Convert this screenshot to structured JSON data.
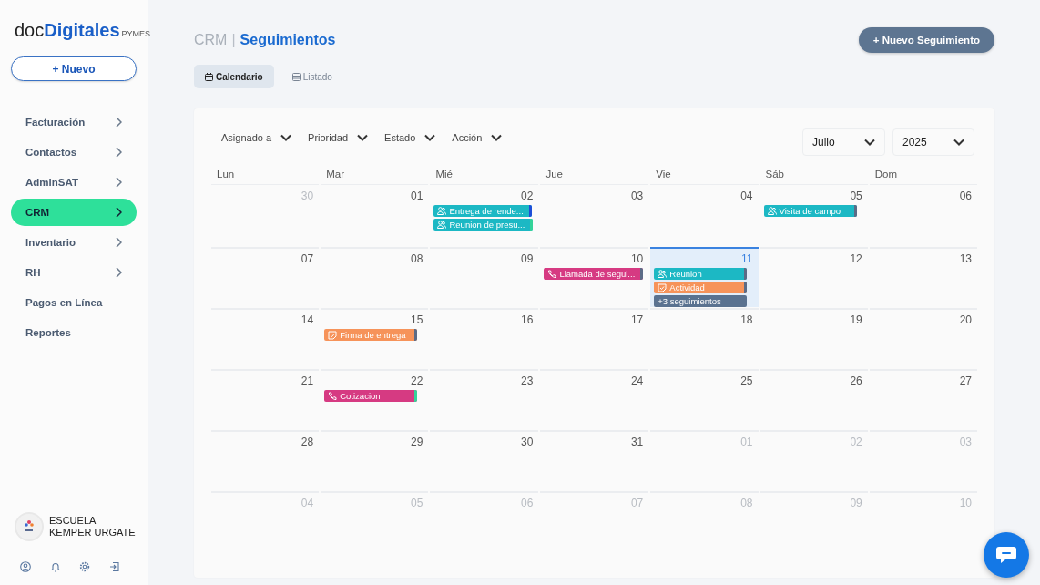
{
  "sidebar": {
    "logo": {
      "prefix": "doc",
      "brand": "Digitales",
      "suffix": "PYMES"
    },
    "new_button": {
      "icon": "+",
      "label": "Nuevo"
    },
    "items": [
      {
        "label": "Facturación",
        "has_submenu": true,
        "selected": false
      },
      {
        "label": "Contactos",
        "has_submenu": true,
        "selected": false
      },
      {
        "label": "AdminSAT",
        "has_submenu": true,
        "selected": false
      },
      {
        "label": "CRM",
        "has_submenu": true,
        "selected": true
      },
      {
        "label": "Inventario",
        "has_submenu": true,
        "selected": false
      },
      {
        "label": "RH",
        "has_submenu": true,
        "selected": false
      },
      {
        "label": "Pagos en Línea",
        "has_submenu": false,
        "selected": false
      },
      {
        "label": "Reportes",
        "has_submenu": false,
        "selected": false
      }
    ],
    "account": {
      "name": "ESCUELA KEMPER URGATE"
    }
  },
  "header": {
    "section": "CRM",
    "separator": "|",
    "title": "Seguimientos",
    "new_button": {
      "icon": "+",
      "label": "Nuevo Seguimiento"
    }
  },
  "tabs": [
    {
      "label": "Calendario",
      "kind": "calendar",
      "selected": true
    },
    {
      "label": "Listado",
      "kind": "list",
      "selected": false
    }
  ],
  "filters": [
    "Asignado a",
    "Prioridad",
    "Estado",
    "Acción"
  ],
  "month_select": {
    "value": "Julio"
  },
  "year_select": {
    "value": "2025"
  },
  "weekdays": [
    "Lun",
    "Mar",
    "Mié",
    "Jue",
    "Vie",
    "Sáb",
    "Dom"
  ],
  "weeks": [
    [
      {
        "day": "30",
        "outside": true,
        "today": false
      },
      {
        "day": "01",
        "outside": false,
        "today": false
      },
      {
        "day": "02",
        "outside": false,
        "today": false,
        "events": [
          {
            "kind": "meeting",
            "label": "Entrega de rende...",
            "color": "#1cb8c4",
            "stripe": {
              "color": "#1d4ed8"
            }
          },
          {
            "kind": "meeting",
            "label": "Reunion de presu...",
            "color": "#1cb8c4",
            "stripe": {
              "color": "#34d399"
            }
          }
        ]
      },
      {
        "day": "03",
        "outside": false,
        "today": false
      },
      {
        "day": "04",
        "outside": false,
        "today": false
      },
      {
        "day": "05",
        "outside": false,
        "today": false,
        "events": [
          {
            "kind": "meeting",
            "label": "Visita de campo",
            "color": "#1cb8c4",
            "stripe": {
              "color": "#5b6b86"
            }
          }
        ]
      },
      {
        "day": "06",
        "outside": false,
        "today": false
      }
    ],
    [
      {
        "day": "07",
        "outside": false,
        "today": false
      },
      {
        "day": "08",
        "outside": false,
        "today": false
      },
      {
        "day": "09",
        "outside": false,
        "today": false
      },
      {
        "day": "10",
        "outside": false,
        "today": false,
        "events": [
          {
            "kind": "call",
            "label": "Llamada de segui...",
            "color": "#d63a82",
            "stripe": {
              "color": "#5b6b86"
            }
          }
        ]
      },
      {
        "day": "11",
        "outside": false,
        "today": true,
        "events": [
          {
            "kind": "meeting",
            "label": "Reunion",
            "color": "#1cb8c4",
            "stripe": {
              "color": "#5b6b86"
            }
          },
          {
            "kind": "task",
            "label": "Actividad",
            "color": "#f6935a",
            "stripe": {
              "color": "#5b6b86"
            }
          },
          {
            "kind": "more",
            "label": "+3 seguimientos",
            "color": "#5a7290"
          }
        ]
      },
      {
        "day": "12",
        "outside": false,
        "today": false
      },
      {
        "day": "13",
        "outside": false,
        "today": false
      }
    ],
    [
      {
        "day": "14",
        "outside": false,
        "today": false
      },
      {
        "day": "15",
        "outside": false,
        "today": false,
        "events": [
          {
            "kind": "task",
            "label": "Firma de entrega",
            "color": "#f6935a",
            "stripe": {
              "color": "#5b6b86"
            }
          }
        ]
      },
      {
        "day": "16",
        "outside": false,
        "today": false
      },
      {
        "day": "17",
        "outside": false,
        "today": false
      },
      {
        "day": "18",
        "outside": false,
        "today": false
      },
      {
        "day": "19",
        "outside": false,
        "today": false
      },
      {
        "day": "20",
        "outside": false,
        "today": false
      }
    ],
    [
      {
        "day": "21",
        "outside": false,
        "today": false
      },
      {
        "day": "22",
        "outside": false,
        "today": false,
        "events": [
          {
            "kind": "call",
            "label": "Cotizacion",
            "color": "#d63a82",
            "stripe": {
              "color": "#34d399"
            }
          }
        ]
      },
      {
        "day": "23",
        "outside": false,
        "today": false
      },
      {
        "day": "24",
        "outside": false,
        "today": false
      },
      {
        "day": "25",
        "outside": false,
        "today": false
      },
      {
        "day": "26",
        "outside": false,
        "today": false
      },
      {
        "day": "27",
        "outside": false,
        "today": false
      }
    ],
    [
      {
        "day": "28",
        "outside": false,
        "today": false
      },
      {
        "day": "29",
        "outside": false,
        "today": false
      },
      {
        "day": "30",
        "outside": false,
        "today": false
      },
      {
        "day": "31",
        "outside": false,
        "today": false
      },
      {
        "day": "01",
        "outside": true,
        "today": false
      },
      {
        "day": "02",
        "outside": true,
        "today": false
      },
      {
        "day": "03",
        "outside": true,
        "today": false
      }
    ],
    [
      {
        "day": "04",
        "outside": true,
        "today": false
      },
      {
        "day": "05",
        "outside": true,
        "today": false
      },
      {
        "day": "06",
        "outside": true,
        "today": false
      },
      {
        "day": "07",
        "outside": true,
        "today": false
      },
      {
        "day": "08",
        "outside": true,
        "today": false
      },
      {
        "day": "09",
        "outside": true,
        "today": false
      },
      {
        "day": "10",
        "outside": true,
        "today": false
      }
    ]
  ]
}
